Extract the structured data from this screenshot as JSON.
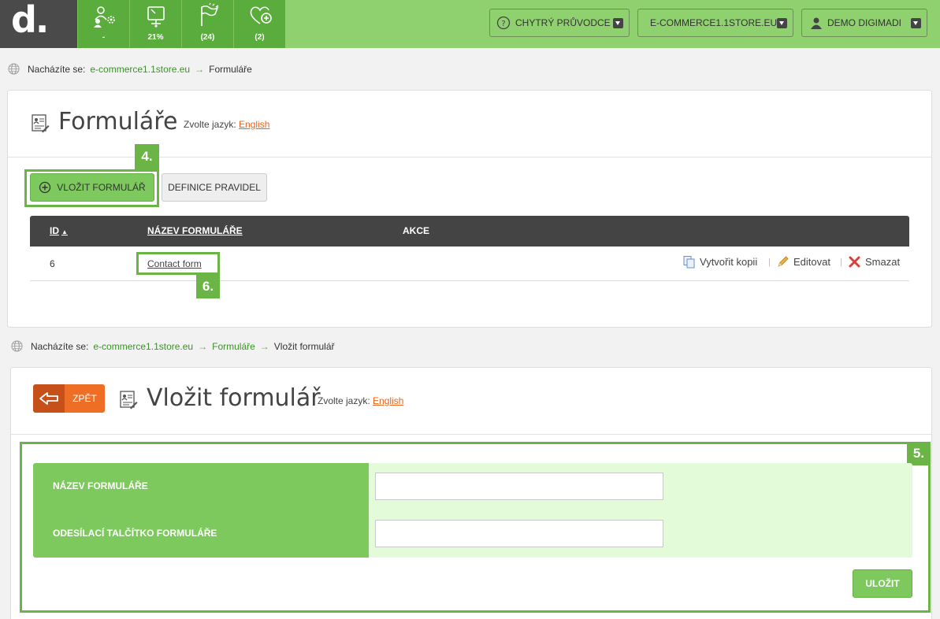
{
  "header": {
    "logo": "d.",
    "stats": [
      {
        "icon": "users-gear-icon",
        "value": "-"
      },
      {
        "icon": "monitor-icon",
        "value": "21%"
      },
      {
        "icon": "flags-icon",
        "value": "(24)"
      },
      {
        "icon": "heart-plus-icon",
        "value": "(2)"
      }
    ],
    "guide_button": "CHYTRÝ PRŮVODCE",
    "shop_button": "E-COMMERCE1.1STORE.EU",
    "user_button": "DEMO DIGIMADI"
  },
  "breadcrumb1": {
    "prefix": "Nacházíte se:",
    "items": [
      "e-commerce1.1store.eu",
      "Formuláře"
    ]
  },
  "forms_panel": {
    "title": "Formuláře",
    "lang_prefix": "Zvolte jazyk:",
    "lang_value": "English",
    "insert_button": "VLOŽIT FORMULÁŘ",
    "rules_button": "DEFINICE PRAVIDEL",
    "callout_insert": "4.",
    "callout_name": "6.",
    "table": {
      "columns": [
        "ID",
        "NÁZEV FORMULÁŘE",
        "AKCE"
      ],
      "rows": [
        {
          "id": "6",
          "name": "Contact form"
        }
      ],
      "actions": {
        "copy": "Vytvořit kopii",
        "edit": "Editovat",
        "delete": "Smazat"
      }
    }
  },
  "breadcrumb2": {
    "prefix": "Nacházíte se:",
    "items": [
      "e-commerce1.1store.eu",
      "Formuláře",
      "Vložit formulář"
    ]
  },
  "insert_panel": {
    "back_button": "ZPĚT",
    "title": "Vložit formulář",
    "lang_prefix": "Zvolte jazyk:",
    "lang_value": "English",
    "callout_form": "5.",
    "fields": [
      {
        "label": "NÁZEV FORMULÁŘE",
        "value": "",
        "placeholder": ""
      },
      {
        "label": "ODESÍLACÍ TALČÍTKO FORMULÁŘE",
        "value": "",
        "placeholder": ""
      }
    ],
    "save_button": "ULOŽIT"
  },
  "colors": {
    "topbar": "#8fd16e",
    "accent_green": "#5aac3c",
    "callout_green": "#6ab545",
    "orange": "#e8641c",
    "dark": "#444444"
  }
}
